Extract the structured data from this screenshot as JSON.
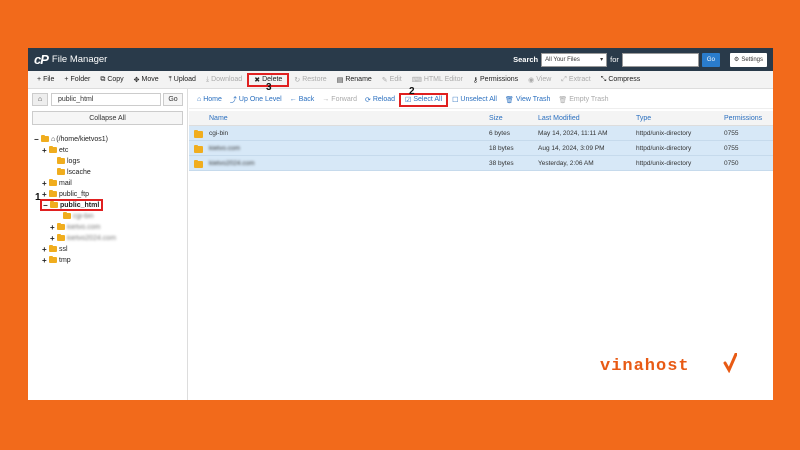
{
  "header": {
    "logo": "cP",
    "title": "File Manager",
    "search_label": "Search",
    "search_scope": "All Your Files",
    "for_label": "for",
    "go_label": "Go",
    "settings_label": "Settings"
  },
  "toolbar": [
    {
      "label": "File",
      "icon": "+",
      "disabled": false
    },
    {
      "label": "Folder",
      "icon": "+",
      "disabled": false
    },
    {
      "label": "Copy",
      "icon": "⧉",
      "disabled": false
    },
    {
      "label": "Move",
      "icon": "✥",
      "disabled": false
    },
    {
      "label": "Upload",
      "icon": "⤒",
      "disabled": false
    },
    {
      "label": "Download",
      "icon": "⤓",
      "disabled": true
    },
    {
      "label": "Delete",
      "icon": "✖",
      "disabled": false,
      "highlight": true
    },
    {
      "label": "Restore",
      "icon": "↻",
      "disabled": true
    },
    {
      "label": "Rename",
      "icon": "▤",
      "disabled": false
    },
    {
      "label": "Edit",
      "icon": "✎",
      "disabled": true
    },
    {
      "label": "HTML Editor",
      "icon": "⌨",
      "disabled": true
    },
    {
      "label": "Permissions",
      "icon": "⚷",
      "disabled": false
    },
    {
      "label": "View",
      "icon": "◉",
      "disabled": true
    },
    {
      "label": "Extract",
      "icon": "⤢",
      "disabled": true
    },
    {
      "label": "Compress",
      "icon": "⤡",
      "disabled": false
    }
  ],
  "left": {
    "path_value": "public_html",
    "go_label": "Go",
    "collapse_label": "Collapse All"
  },
  "tree": [
    {
      "label": "(/home/kietvos1)",
      "toggle": "−",
      "home": true,
      "blur": false,
      "selected": false
    },
    {
      "label": "etc",
      "toggle": "+",
      "blur": false,
      "selected": false
    },
    {
      "label": "logs",
      "toggle": "",
      "blur": false,
      "selected": false
    },
    {
      "label": "lscache",
      "toggle": "",
      "blur": false,
      "selected": false
    },
    {
      "label": "mail",
      "toggle": "+",
      "blur": false,
      "selected": false
    },
    {
      "label": "public_ftp",
      "toggle": "+",
      "blur": false,
      "selected": false
    },
    {
      "label": "public_html",
      "toggle": "−",
      "blur": false,
      "selected": true
    },
    {
      "label": "cgi-bin",
      "toggle": "",
      "blur": true,
      "selected": false
    },
    {
      "label": "kietvo.com",
      "toggle": "+",
      "blur": true,
      "selected": false
    },
    {
      "label": "kietvo2024.com",
      "toggle": "+",
      "blur": true,
      "selected": false
    },
    {
      "label": "ssl",
      "toggle": "+",
      "blur": false,
      "selected": false
    },
    {
      "label": "tmp",
      "toggle": "+",
      "blur": false,
      "selected": false
    }
  ],
  "navbar": [
    {
      "label": "Home",
      "icon": "⌂",
      "disabled": false
    },
    {
      "label": "Up One Level",
      "icon": "⤴",
      "disabled": false
    },
    {
      "label": "Back",
      "icon": "←",
      "disabled": false
    },
    {
      "label": "Forward",
      "icon": "→",
      "disabled": true
    },
    {
      "label": "Reload",
      "icon": "⟳",
      "disabled": false
    },
    {
      "label": "Select All",
      "icon": "☑",
      "disabled": false,
      "highlight": true
    },
    {
      "label": "Unselect All",
      "icon": "☐",
      "disabled": false
    },
    {
      "label": "View Trash",
      "icon": "🗑",
      "disabled": false
    },
    {
      "label": "Empty Trash",
      "icon": "🗑",
      "disabled": true
    }
  ],
  "table": {
    "columns": [
      "Name",
      "Size",
      "Last Modified",
      "Type",
      "Permissions"
    ],
    "rows": [
      {
        "name": "cgi-bin",
        "size": "6 bytes",
        "modified": "May 14, 2024, 11:11 AM",
        "type": "httpd/unix-directory",
        "perms": "0755",
        "blur": false
      },
      {
        "name": "kietvo.com",
        "size": "18 bytes",
        "modified": "Aug 14, 2024, 3:09 PM",
        "type": "httpd/unix-directory",
        "perms": "0755",
        "blur": true
      },
      {
        "name": "kietvo2024.com",
        "size": "38 bytes",
        "modified": "Yesterday, 2:06 AM",
        "type": "httpd/unix-directory",
        "perms": "0750",
        "blur": true
      }
    ]
  },
  "callouts": {
    "one": "1",
    "two": "2",
    "three": "3"
  },
  "brand": "vinahost",
  "colors": {
    "background": "#f26a1b",
    "topbar": "#293a4a",
    "highlight": "#e02020",
    "selected_row": "#d7e8f7",
    "link": "#2a6fbf",
    "folder": "#f0ad1e"
  }
}
